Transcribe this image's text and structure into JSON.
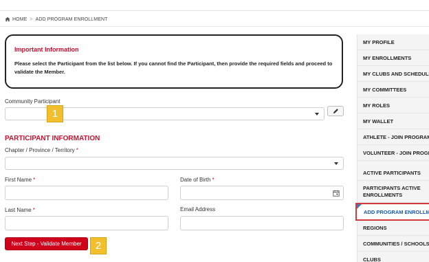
{
  "breadcrumb": {
    "home": "HOME",
    "separator": ">",
    "current": "ADD PROGRAM ENROLLMENT"
  },
  "info": {
    "title": "Important Information",
    "body": "Please select the Participant from the list below.  If you cannot find the Participant, then provide the required fields and proceed to validate the Member."
  },
  "form": {
    "community_participant_label": "Community Participant",
    "section_title": "PARTICIPANT INFORMATION",
    "chapter_label": "Chapter / Province / Territory",
    "first_name_label": "First Name",
    "dob_label": "Date of Birth",
    "last_name_label": "Last Name",
    "email_label": "Email Address",
    "required_marker": "*",
    "next_button": "Next Step - Validate Member"
  },
  "callouts": {
    "one": "1",
    "two": "2"
  },
  "sidebar": {
    "items": [
      {
        "label": "MY PROFILE"
      },
      {
        "label": "MY ENROLLMENTS"
      },
      {
        "label": "MY CLUBS AND SCHEDULE"
      },
      {
        "label": "MY COMMITTEES"
      },
      {
        "label": "MY ROLES"
      },
      {
        "label": "MY WALLET"
      },
      {
        "label": "ATHLETE - JOIN PROGRAM"
      },
      {
        "label": "VOLUNTEER - JOIN PROGRAM"
      },
      {
        "label": "ACTIVE PARTICIPANTS"
      },
      {
        "label": "PARTICIPANTS ACTIVE ENROLLMENTS"
      },
      {
        "label": "ADD PROGRAM ENROLLMENT"
      },
      {
        "label": "REGIONS"
      },
      {
        "label": "COMMUNITIES / SCHOOLS"
      },
      {
        "label": "CLUBS"
      }
    ]
  },
  "colors": {
    "accent_red": "#c8102e",
    "button_red": "#d0021b",
    "callout_yellow": "#f2bf2f",
    "active_link_blue": "#1a5aa8"
  },
  "icons": {
    "home": "home-icon",
    "edit": "pencil-icon",
    "calendar": "calendar-icon",
    "dropdown": "chevron-down-icon"
  }
}
